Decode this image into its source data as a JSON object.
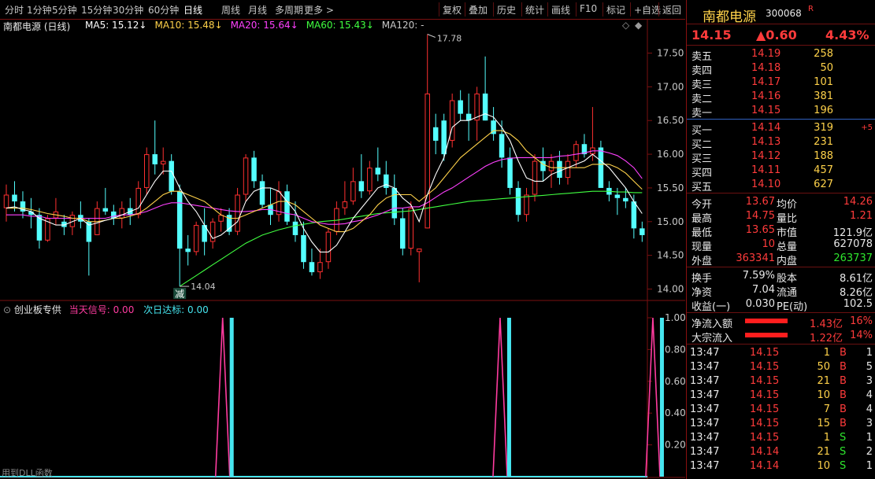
{
  "toolbar": {
    "left_items": [
      "分时",
      "1分钟",
      "5分钟",
      "15分钟",
      "30分钟",
      "60分钟",
      "日线",
      "周线",
      "月线",
      "多周期",
      "更多 >"
    ],
    "active": "日线",
    "right_items": [
      "复权",
      "叠加",
      "历史",
      "统计",
      "画线",
      "F10",
      "标记",
      "+自选",
      "返回"
    ]
  },
  "chart": {
    "title": "南都电源 (日线)",
    "ma_labels": [
      {
        "text": "MA5: 15.12↓",
        "color": "#ffffff"
      },
      {
        "text": "MA10: 15.48↓",
        "color": "#ffd24a"
      },
      {
        "text": "MA20: 15.64↓",
        "color": "#ff40ff"
      },
      {
        "text": "MA60: 15.43↓",
        "color": "#40ff40"
      },
      {
        "text": "MA120: -",
        "color": "#c8c8c8"
      }
    ],
    "max_label": "17.78",
    "min_label": "14.04",
    "signal_mark": "减",
    "colors": {
      "up": "#ff3030",
      "down": "#54ffff",
      "ma5": "#ffffff",
      "ma10": "#ffd24a",
      "ma20": "#ff40ff",
      "ma60": "#40ff40",
      "grid": "#7a1010"
    }
  },
  "chart_data": [
    {
      "type": "candlestick",
      "title": "南都电源 (日线)",
      "ylim": [
        13.9,
        17.78
      ],
      "yticks": [
        "17.50",
        "17.00",
        "16.50",
        "16.00",
        "15.50",
        "15.00",
        "14.50",
        "14.00"
      ],
      "ohlc": [
        [
          15.2,
          15.55,
          15.0,
          15.4
        ],
        [
          15.4,
          15.6,
          15.15,
          15.3
        ],
        [
          15.3,
          15.45,
          15.05,
          15.15
        ],
        [
          15.15,
          15.35,
          14.9,
          15.1
        ],
        [
          15.1,
          15.2,
          14.6,
          14.72
        ],
        [
          14.72,
          15.1,
          14.7,
          15.05
        ],
        [
          15.05,
          15.35,
          14.95,
          15.15
        ],
        [
          15.0,
          15.1,
          14.8,
          14.92
        ],
        [
          14.92,
          15.15,
          14.8,
          15.1
        ],
        [
          15.1,
          15.3,
          14.9,
          15.0
        ],
        [
          15.0,
          15.05,
          14.2,
          14.7
        ],
        [
          14.8,
          15.3,
          14.8,
          15.2
        ],
        [
          15.2,
          15.5,
          15.1,
          15.15
        ],
        [
          15.15,
          15.25,
          14.95,
          15.05
        ],
        [
          15.05,
          15.3,
          14.9,
          15.2
        ],
        [
          15.2,
          15.35,
          14.95,
          15.1
        ],
        [
          15.1,
          15.6,
          15.05,
          15.5
        ],
        [
          15.5,
          16.1,
          15.4,
          16.0
        ],
        [
          16.0,
          16.5,
          15.7,
          15.85
        ],
        [
          15.85,
          16.1,
          15.7,
          15.9
        ],
        [
          15.9,
          16.0,
          15.4,
          15.45
        ],
        [
          15.45,
          15.55,
          14.04,
          14.6
        ],
        [
          14.6,
          14.8,
          14.35,
          14.55
        ],
        [
          14.55,
          15.0,
          14.5,
          14.95
        ],
        [
          14.95,
          15.2,
          14.5,
          14.7
        ],
        [
          14.7,
          15.05,
          14.6,
          15.0
        ],
        [
          15.0,
          15.2,
          14.85,
          15.1
        ],
        [
          15.1,
          15.2,
          14.8,
          14.85
        ],
        [
          14.85,
          15.5,
          14.8,
          15.4
        ],
        [
          15.4,
          16.0,
          15.3,
          15.95
        ],
        [
          15.95,
          16.05,
          15.5,
          15.6
        ],
        [
          15.6,
          15.7,
          15.2,
          15.25
        ],
        [
          15.25,
          15.5,
          14.95,
          15.1
        ],
        [
          15.1,
          15.6,
          15.0,
          15.45
        ],
        [
          15.45,
          15.55,
          14.95,
          15.0
        ],
        [
          15.0,
          15.3,
          14.7,
          14.8
        ],
        [
          14.8,
          15.0,
          14.3,
          14.4
        ],
        [
          14.4,
          14.6,
          14.2,
          14.25
        ],
        [
          14.25,
          14.6,
          14.15,
          14.4
        ],
        [
          14.4,
          14.9,
          14.3,
          14.85
        ],
        [
          14.85,
          15.3,
          14.8,
          15.2
        ],
        [
          15.2,
          15.6,
          15.1,
          15.3
        ],
        [
          15.3,
          15.8,
          15.25,
          15.6
        ],
        [
          15.6,
          16.0,
          15.35,
          15.45
        ],
        [
          15.45,
          15.9,
          15.4,
          15.8
        ],
        [
          15.8,
          16.1,
          15.6,
          15.7
        ],
        [
          15.7,
          15.9,
          15.4,
          15.5
        ],
        [
          15.5,
          15.7,
          14.95,
          15.05
        ],
        [
          15.05,
          15.2,
          14.5,
          14.6
        ],
        [
          14.6,
          15.3,
          14.5,
          15.2
        ],
        [
          14.55,
          14.6,
          14.1,
          14.6
        ],
        [
          14.9,
          17.78,
          14.9,
          16.9
        ],
        [
          16.4,
          16.6,
          16.0,
          16.2
        ],
        [
          16.5,
          16.6,
          15.9,
          16.0
        ],
        [
          16.2,
          16.9,
          16.1,
          16.8
        ],
        [
          16.8,
          16.95,
          16.5,
          16.6
        ],
        [
          16.6,
          16.9,
          16.2,
          16.5
        ],
        [
          16.5,
          17.0,
          16.2,
          16.9
        ],
        [
          16.9,
          17.45,
          16.5,
          16.5
        ],
        [
          16.5,
          16.7,
          16.2,
          16.3
        ],
        [
          16.3,
          16.5,
          15.8,
          15.95
        ],
        [
          15.95,
          16.1,
          15.4,
          15.5
        ],
        [
          15.5,
          15.6,
          15.0,
          15.1
        ],
        [
          15.1,
          15.5,
          15.0,
          15.4
        ],
        [
          15.4,
          16.0,
          15.3,
          15.9
        ],
        [
          15.9,
          16.1,
          15.6,
          15.75
        ],
        [
          15.75,
          16.0,
          15.5,
          15.9
        ],
        [
          15.9,
          16.05,
          15.55,
          15.65
        ],
        [
          15.65,
          16.0,
          15.55,
          15.9
        ],
        [
          15.9,
          16.2,
          15.8,
          16.15
        ],
        [
          16.15,
          16.3,
          15.95,
          16.0
        ],
        [
          16.0,
          16.7,
          15.9,
          16.1
        ],
        [
          16.1,
          16.2,
          15.5,
          15.5
        ],
        [
          15.5,
          15.6,
          15.3,
          15.4
        ],
        [
          15.4,
          15.5,
          15.1,
          15.35
        ],
        [
          15.35,
          15.5,
          15.2,
          15.3
        ],
        [
          15.3,
          15.4,
          14.75,
          14.9
        ],
        [
          14.9,
          15.0,
          14.7,
          14.8
        ]
      ],
      "ma5": [
        15.2,
        15.22,
        15.18,
        15.15,
        15.05,
        15.0,
        14.95,
        14.95,
        15.0,
        15.05,
        14.95,
        14.98,
        15.02,
        15.05,
        15.1,
        15.15,
        15.2,
        15.4,
        15.6,
        15.75,
        15.75,
        15.5,
        15.3,
        15.15,
        14.95,
        14.75,
        14.8,
        14.9,
        15.0,
        15.3,
        15.45,
        15.5,
        15.5,
        15.45,
        15.3,
        15.15,
        14.9,
        14.7,
        14.55,
        14.55,
        14.65,
        14.85,
        15.05,
        15.2,
        15.35,
        15.5,
        15.55,
        15.5,
        15.35,
        15.25,
        15.0,
        15.4,
        15.7,
        15.95,
        16.4,
        16.5,
        16.5,
        16.55,
        16.6,
        16.55,
        16.4,
        16.2,
        15.9,
        15.65,
        15.6,
        15.6,
        15.7,
        15.75,
        15.8,
        15.85,
        15.9,
        16.0,
        15.9,
        15.8,
        15.65,
        15.5,
        15.3,
        15.12
      ],
      "ma10": [
        15.2,
        15.2,
        15.2,
        15.18,
        15.15,
        15.12,
        15.1,
        15.08,
        15.05,
        15.05,
        15.0,
        15.0,
        15.02,
        15.05,
        15.05,
        15.08,
        15.12,
        15.2,
        15.3,
        15.4,
        15.45,
        15.45,
        15.4,
        15.35,
        15.3,
        15.2,
        15.1,
        15.05,
        15.05,
        15.1,
        15.15,
        15.2,
        15.25,
        15.3,
        15.3,
        15.25,
        15.15,
        15.05,
        14.95,
        14.9,
        14.85,
        14.85,
        14.9,
        15.0,
        15.1,
        15.25,
        15.35,
        15.4,
        15.4,
        15.4,
        15.3,
        15.4,
        15.5,
        15.65,
        15.8,
        15.95,
        16.05,
        16.15,
        16.25,
        16.35,
        16.35,
        16.3,
        16.2,
        16.05,
        15.95,
        15.85,
        15.8,
        15.8,
        15.8,
        15.8,
        15.8,
        15.85,
        15.85,
        15.85,
        15.8,
        15.72,
        15.6,
        15.48
      ],
      "ma20": [
        15.1,
        15.1,
        15.1,
        15.08,
        15.08,
        15.05,
        15.05,
        15.05,
        15.05,
        15.05,
        15.05,
        15.05,
        15.05,
        15.08,
        15.1,
        15.1,
        15.12,
        15.15,
        15.2,
        15.25,
        15.28,
        15.28,
        15.26,
        15.24,
        15.22,
        15.2,
        15.18,
        15.16,
        15.15,
        15.15,
        15.16,
        15.18,
        15.18,
        15.15,
        15.12,
        15.1,
        15.05,
        15.0,
        14.98,
        14.96,
        14.96,
        14.97,
        15.0,
        15.02,
        15.06,
        15.1,
        15.15,
        15.2,
        15.2,
        15.22,
        15.22,
        15.28,
        15.36,
        15.44,
        15.5,
        15.58,
        15.66,
        15.74,
        15.82,
        15.88,
        15.92,
        15.94,
        15.95,
        15.95,
        15.95,
        15.95,
        15.95,
        15.97,
        15.98,
        16.0,
        16.02,
        16.05,
        16.05,
        16.02,
        15.98,
        15.9,
        15.8,
        15.64
      ],
      "ma60": [
        null,
        null,
        null,
        null,
        null,
        null,
        null,
        null,
        null,
        null,
        null,
        null,
        null,
        null,
        null,
        null,
        null,
        null,
        null,
        null,
        null,
        14.04,
        14.12,
        14.2,
        14.28,
        14.36,
        14.44,
        14.52,
        14.6,
        14.68,
        14.74,
        14.8,
        14.84,
        14.88,
        14.91,
        14.94,
        14.96,
        14.98,
        15.0,
        15.01,
        15.02,
        15.04,
        15.06,
        15.08,
        15.1,
        15.12,
        15.13,
        15.14,
        15.15,
        15.16,
        15.18,
        15.2,
        15.22,
        15.24,
        15.26,
        15.28,
        15.3,
        15.31,
        15.32,
        15.33,
        15.34,
        15.35,
        15.36,
        15.37,
        15.38,
        15.39,
        15.4,
        15.41,
        15.42,
        15.43,
        15.44,
        15.45,
        15.45,
        15.45,
        15.44,
        15.44,
        15.43,
        15.43
      ]
    },
    {
      "type": "line",
      "title": "创业板专供",
      "series": [
        {
          "name": "当天信号",
          "color": "#ff3ca0",
          "peaks_at": [
            14,
            31,
            41
          ]
        },
        {
          "name": "次日达标",
          "color": "#46e6f0",
          "peaks_at": [
            15,
            32,
            42
          ]
        }
      ],
      "ylim": [
        0,
        1.0
      ],
      "yticks": [
        "1.00",
        "0.80",
        "0.60",
        "0.40",
        "0.20"
      ]
    }
  ],
  "indicator": {
    "name": "创业板专供",
    "sig1_label": "当天信号:",
    "sig1_value": "0.00",
    "sig2_label": "次日达标:",
    "sig2_value": "0.00",
    "footer": "用到DLL函数"
  },
  "quote": {
    "name": "南都电源",
    "code": "300068",
    "badge": "R",
    "price": "14.15",
    "change": "▲0.60",
    "pct": "4.43%",
    "asks": [
      {
        "label": "卖五",
        "price": "14.19",
        "vol": "258"
      },
      {
        "label": "卖四",
        "price": "14.18",
        "vol": "50"
      },
      {
        "label": "卖三",
        "price": "14.17",
        "vol": "101"
      },
      {
        "label": "卖二",
        "price": "14.16",
        "vol": "381"
      },
      {
        "label": "卖一",
        "price": "14.15",
        "vol": "196"
      }
    ],
    "bids": [
      {
        "label": "买一",
        "price": "14.14",
        "vol": "319",
        "extra": "+5"
      },
      {
        "label": "买二",
        "price": "14.13",
        "vol": "231",
        "extra": ""
      },
      {
        "label": "买三",
        "price": "14.12",
        "vol": "188",
        "extra": ""
      },
      {
        "label": "买四",
        "price": "14.11",
        "vol": "457",
        "extra": ""
      },
      {
        "label": "买五",
        "price": "14.10",
        "vol": "627",
        "extra": ""
      }
    ],
    "stats": [
      {
        "l1": "今开",
        "v1": "13.67",
        "c1": "red",
        "l2": "均价",
        "v2": "14.26",
        "c2": "red"
      },
      {
        "l1": "最高",
        "v1": "14.75",
        "c1": "red",
        "l2": "量比",
        "v2": "1.21",
        "c2": "red"
      },
      {
        "l1": "最低",
        "v1": "13.65",
        "c1": "red",
        "l2": "市值",
        "v2": "121.9亿",
        "c2": "white"
      },
      {
        "l1": "现量",
        "v1": "10",
        "c1": "red",
        "l2": "总量",
        "v2": "627078",
        "c2": "white"
      },
      {
        "l1": "外盘",
        "v1": "363341",
        "c1": "red",
        "l2": "内盘",
        "v2": "263737",
        "c2": "green"
      }
    ],
    "fund": [
      {
        "l1": "换手",
        "v1": "7.59%",
        "l2": "股本",
        "v2": "8.61亿"
      },
      {
        "l1": "净资",
        "v1": "7.04",
        "l2": "流通",
        "v2": "8.26亿"
      },
      {
        "l1": "收益(一)",
        "v1": "0.030",
        "l2": "PE(动)",
        "v2": "102.5"
      }
    ],
    "flows": [
      {
        "label": "净流入额",
        "value": "1.43亿",
        "pct": "16%"
      },
      {
        "label": "大宗流入",
        "value": "1.22亿",
        "pct": "14%"
      }
    ],
    "trades": [
      {
        "time": "13:47",
        "price": "14.15",
        "vol": "1",
        "side": "B",
        "n": "1"
      },
      {
        "time": "13:47",
        "price": "14.15",
        "vol": "50",
        "side": "B",
        "n": "5"
      },
      {
        "time": "13:47",
        "price": "14.15",
        "vol": "21",
        "side": "B",
        "n": "3"
      },
      {
        "time": "13:47",
        "price": "14.15",
        "vol": "10",
        "side": "B",
        "n": "4"
      },
      {
        "time": "13:47",
        "price": "14.15",
        "vol": "7",
        "side": "B",
        "n": "4"
      },
      {
        "time": "13:47",
        "price": "14.15",
        "vol": "15",
        "side": "B",
        "n": "3"
      },
      {
        "time": "13:47",
        "price": "14.15",
        "vol": "1",
        "side": "S",
        "n": "1"
      },
      {
        "time": "13:47",
        "price": "14.14",
        "vol": "21",
        "side": "S",
        "n": "2"
      },
      {
        "time": "13:47",
        "price": "14.14",
        "vol": "10",
        "side": "S",
        "n": "1"
      }
    ]
  }
}
